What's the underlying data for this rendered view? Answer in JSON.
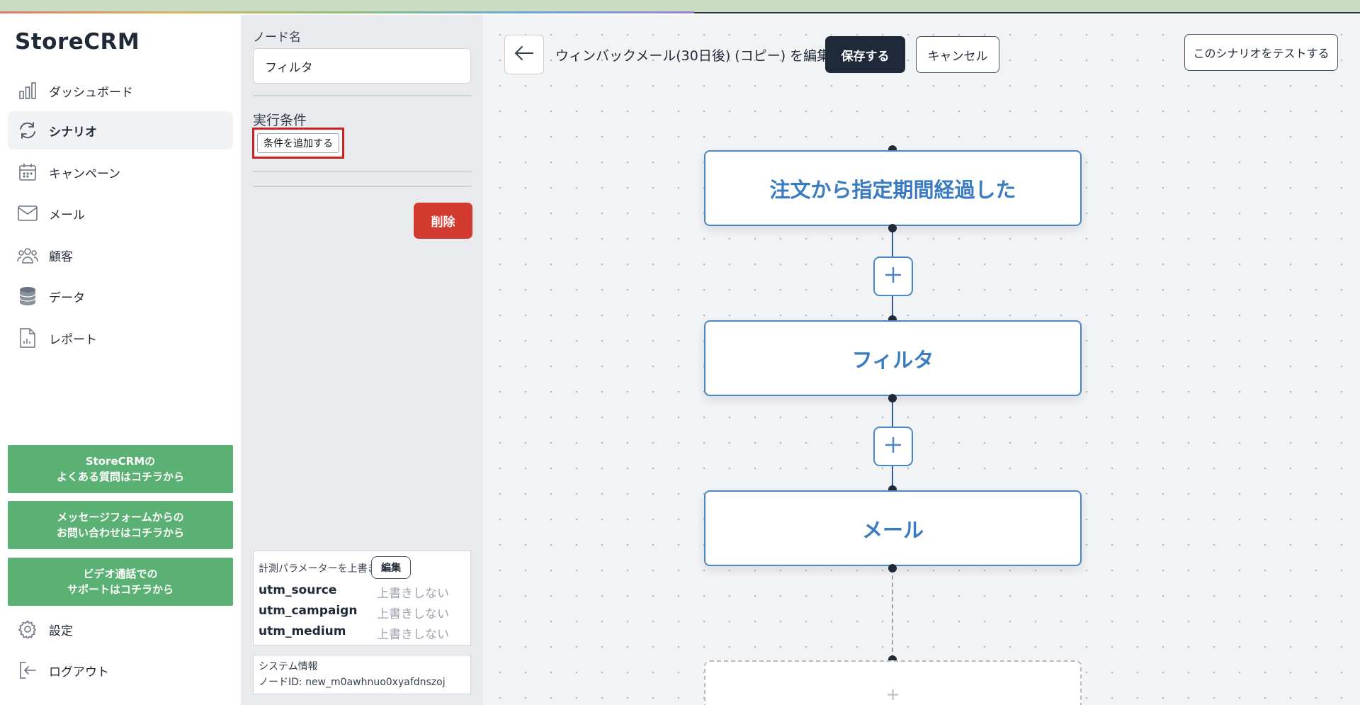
{
  "app": {
    "logo": "StoreCRM"
  },
  "sidebar": {
    "items": [
      {
        "label": "ダッシュボード",
        "icon": "bar-chart-icon"
      },
      {
        "label": "シナリオ",
        "icon": "refresh-icon",
        "active": true
      },
      {
        "label": "キャンペーン",
        "icon": "calendar-icon"
      },
      {
        "label": "メール",
        "icon": "mail-icon"
      },
      {
        "label": "顧客",
        "icon": "users-icon"
      },
      {
        "label": "データ",
        "icon": "database-icon"
      },
      {
        "label": "レポート",
        "icon": "report-icon"
      }
    ],
    "help_buttons": [
      {
        "line1": "StoreCRMの",
        "line2": "よくある質問はコチラから"
      },
      {
        "line1": "メッセージフォームからの",
        "line2": "お問い合わせはコチラから"
      },
      {
        "line1": "ビデオ通話での",
        "line2": "サポートはコチラから"
      }
    ],
    "settings": {
      "label": "設定",
      "icon": "gear-icon"
    },
    "logout": {
      "label": "ログアウト",
      "icon": "logout-icon"
    }
  },
  "panel": {
    "node_name_label": "ノード名",
    "node_name_value": "フィルタ",
    "condition_label": "実行条件",
    "add_condition_label": "条件を追加する",
    "delete_label": "削除",
    "utm": {
      "header": "計測パラメーターを上書き",
      "edit_label": "編集",
      "rows": [
        {
          "key": "utm_source",
          "value": "上書きしない"
        },
        {
          "key": "utm_campaign",
          "value": "上書きしない"
        },
        {
          "key": "utm_medium",
          "value": "上書きしない"
        }
      ]
    },
    "system": {
      "title": "システム情報",
      "node_id": "ノードID: new_m0awhnuo0xyafdnszoj"
    }
  },
  "editor": {
    "title": "ウィンバックメール(30日後) (コピー) を編集中",
    "save_label": "保存する",
    "cancel_label": "キャンセル",
    "test_label": "このシナリオをテストする",
    "nodes": [
      {
        "label": "注文から指定期間経過した"
      },
      {
        "label": "フィルタ"
      },
      {
        "label": "メール"
      }
    ],
    "placeholder_node": "+"
  },
  "colors": {
    "accent": "#3a7bc1",
    "primary_dark": "#1e2a3a",
    "danger": "#d33a2f",
    "help_green": "#5bb074",
    "highlight": "#d02121"
  }
}
